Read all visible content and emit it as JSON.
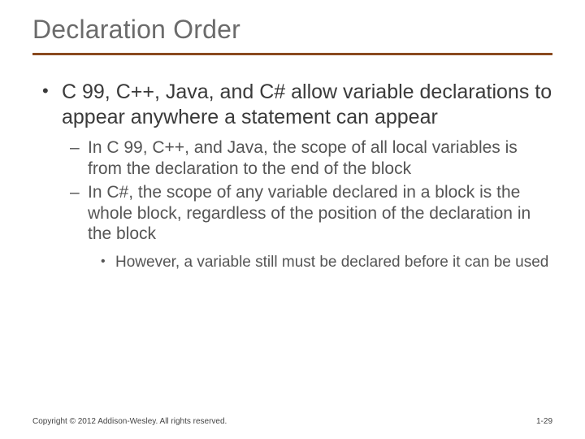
{
  "title": "Declaration Order",
  "bullets": {
    "l1_0": "C 99, C++, Java, and C# allow variable declarations to appear anywhere a statement can appear",
    "l2_0": "In C 99, C++, and Java, the scope of all local variables is from the declaration to the end of the block",
    "l2_1": "In C#, the scope of any variable declared in a block is the whole block, regardless of the position of the declaration in the block",
    "l3_0": "However, a variable still must be declared before it can be used"
  },
  "footer": {
    "copyright": "Copyright © 2012 Addison-Wesley. All rights reserved.",
    "page": "1-29"
  }
}
